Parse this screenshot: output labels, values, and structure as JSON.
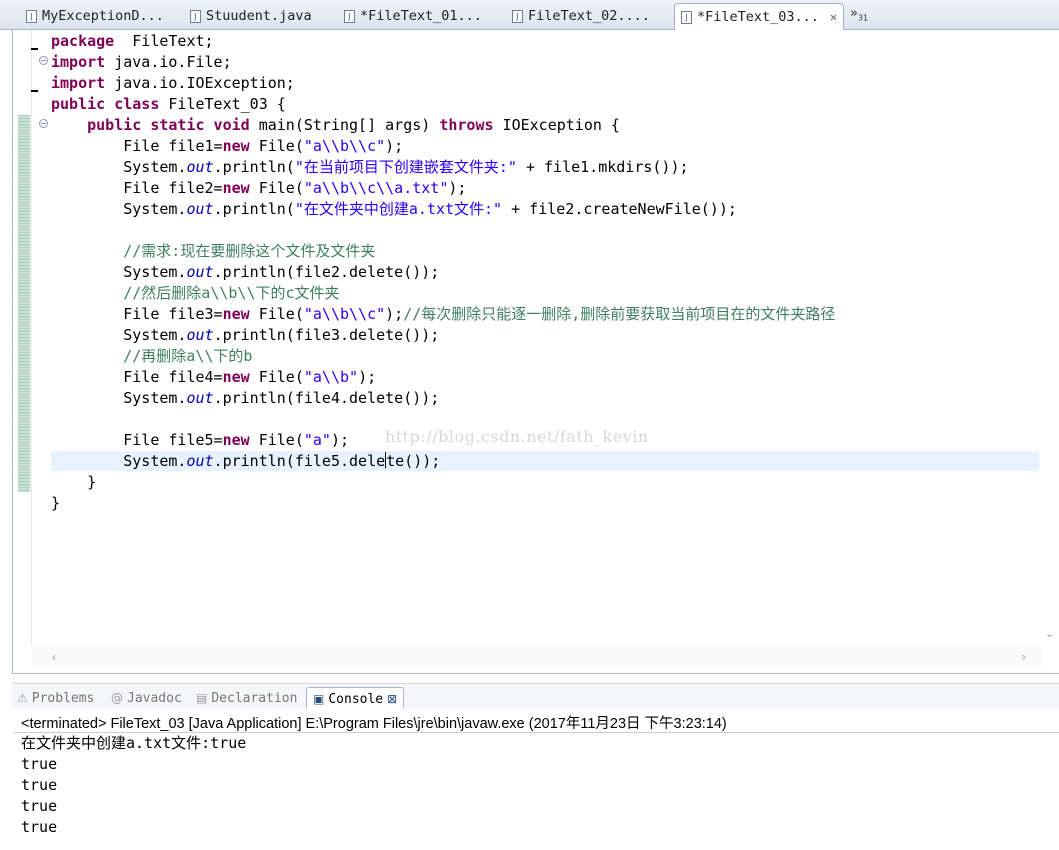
{
  "tabs": [
    {
      "label": "MyExceptionD...",
      "active": false
    },
    {
      "label": "Stuudent.java",
      "active": false
    },
    {
      "label": "*FileText_01...",
      "active": false
    },
    {
      "label": "FileText_02....",
      "active": false
    },
    {
      "label": "*FileText_03...",
      "active": true
    }
  ],
  "tab_overflow": {
    "label": "»",
    "count": "31"
  },
  "code_lines": [
    [
      [
        "kw",
        "package"
      ],
      [
        "",
        "  FileText;"
      ]
    ],
    [
      [
        "kw",
        "import"
      ],
      [
        "",
        " java.io.File;"
      ]
    ],
    [
      [
        "kw",
        "import"
      ],
      [
        "",
        " java.io.IOException;"
      ]
    ],
    [
      [
        "kw",
        "public"
      ],
      [
        "",
        ""
      ],
      [
        "kw",
        " class"
      ],
      [
        "",
        " FileText_03 {"
      ]
    ],
    [
      [
        "",
        "    "
      ],
      [
        "kw",
        "public"
      ],
      [
        "kw",
        " static"
      ],
      [
        "kw",
        " void"
      ],
      [
        "",
        " main(String[] args) "
      ],
      [
        "kw",
        "throws"
      ],
      [
        "",
        " IOException {"
      ]
    ],
    [
      [
        "",
        "        File file1="
      ],
      [
        "kw",
        "new"
      ],
      [
        "",
        " File("
      ],
      [
        "str",
        "\"a\\\\b\\\\c\""
      ],
      [
        "",
        ");"
      ]
    ],
    [
      [
        "",
        "        System."
      ],
      [
        "fld",
        "out"
      ],
      [
        "",
        ".println("
      ],
      [
        "str",
        "\"在当前项目下创建嵌套文件夹:\""
      ],
      [
        "",
        " + file1.mkdirs());"
      ]
    ],
    [
      [
        "",
        "        File file2="
      ],
      [
        "kw",
        "new"
      ],
      [
        "",
        " File("
      ],
      [
        "str",
        "\"a\\\\b\\\\c\\\\a.txt\""
      ],
      [
        "",
        ");"
      ]
    ],
    [
      [
        "",
        "        System."
      ],
      [
        "fld",
        "out"
      ],
      [
        "",
        ".println("
      ],
      [
        "str",
        "\"在文件夹中创建a.txt文件:\""
      ],
      [
        "",
        " + file2.createNewFile());"
      ]
    ],
    [
      [
        "",
        ""
      ]
    ],
    [
      [
        "",
        "        "
      ],
      [
        "cm",
        "//需求:现在要删除这个文件及文件夹"
      ]
    ],
    [
      [
        "",
        "        System."
      ],
      [
        "fld",
        "out"
      ],
      [
        "",
        ".println(file2.delete());"
      ]
    ],
    [
      [
        "",
        "        "
      ],
      [
        "cm",
        "//然后删除a\\\\b\\\\下的c文件夹"
      ]
    ],
    [
      [
        "",
        "        File file3="
      ],
      [
        "kw",
        "new"
      ],
      [
        "",
        " File("
      ],
      [
        "str",
        "\"a\\\\b\\\\c\""
      ],
      [
        "",
        ");"
      ],
      [
        "cm",
        "//每次删除只能逐一删除,删除前要获取当前项目在的文件夹路径"
      ]
    ],
    [
      [
        "",
        "        System."
      ],
      [
        "fld",
        "out"
      ],
      [
        "",
        ".println(file3.delete());"
      ]
    ],
    [
      [
        "",
        "        "
      ],
      [
        "cm",
        "//再删除a\\\\下的b"
      ]
    ],
    [
      [
        "",
        "        File file4="
      ],
      [
        "kw",
        "new"
      ],
      [
        "",
        " File("
      ],
      [
        "str",
        "\"a\\\\b\""
      ],
      [
        "",
        ");"
      ]
    ],
    [
      [
        "",
        "        System."
      ],
      [
        "fld",
        "out"
      ],
      [
        "",
        ".println(file4.delete());"
      ]
    ],
    [
      [
        "",
        ""
      ]
    ],
    [
      [
        "",
        "        File file5="
      ],
      [
        "kw",
        "new"
      ],
      [
        "",
        " File("
      ],
      [
        "str",
        "\"a\""
      ],
      [
        "",
        ");"
      ]
    ],
    [
      [
        "",
        "        System."
      ],
      [
        "fld",
        "out"
      ],
      [
        "",
        ".println(file5.dele"
      ],
      [
        "caret",
        ""
      ],
      [
        "",
        "te());"
      ]
    ],
    [
      [
        "",
        "    }"
      ]
    ],
    [
      [
        "",
        "}"
      ]
    ]
  ],
  "watermark": "http://blog.csdn.net/fath_kevin",
  "views": [
    {
      "label": "Problems",
      "icon": "problems-icon",
      "glyph": "⚠",
      "active": false
    },
    {
      "label": "Javadoc",
      "icon": "javadoc-icon",
      "glyph": "@",
      "active": false
    },
    {
      "label": "Declaration",
      "icon": "declaration-icon",
      "glyph": "▤",
      "active": false
    },
    {
      "label": "Console",
      "icon": "console-icon",
      "glyph": "▣",
      "active": true,
      "close": "⊠"
    }
  ],
  "console": {
    "status": "<terminated> FileText_03 [Java Application] E:\\Program Files\\jre\\bin\\javaw.exe (2017年11月23日 下午3:23:14)",
    "output": [
      "在文件夹中创建a.txt文件:true",
      "true",
      "true",
      "true",
      "true"
    ]
  }
}
